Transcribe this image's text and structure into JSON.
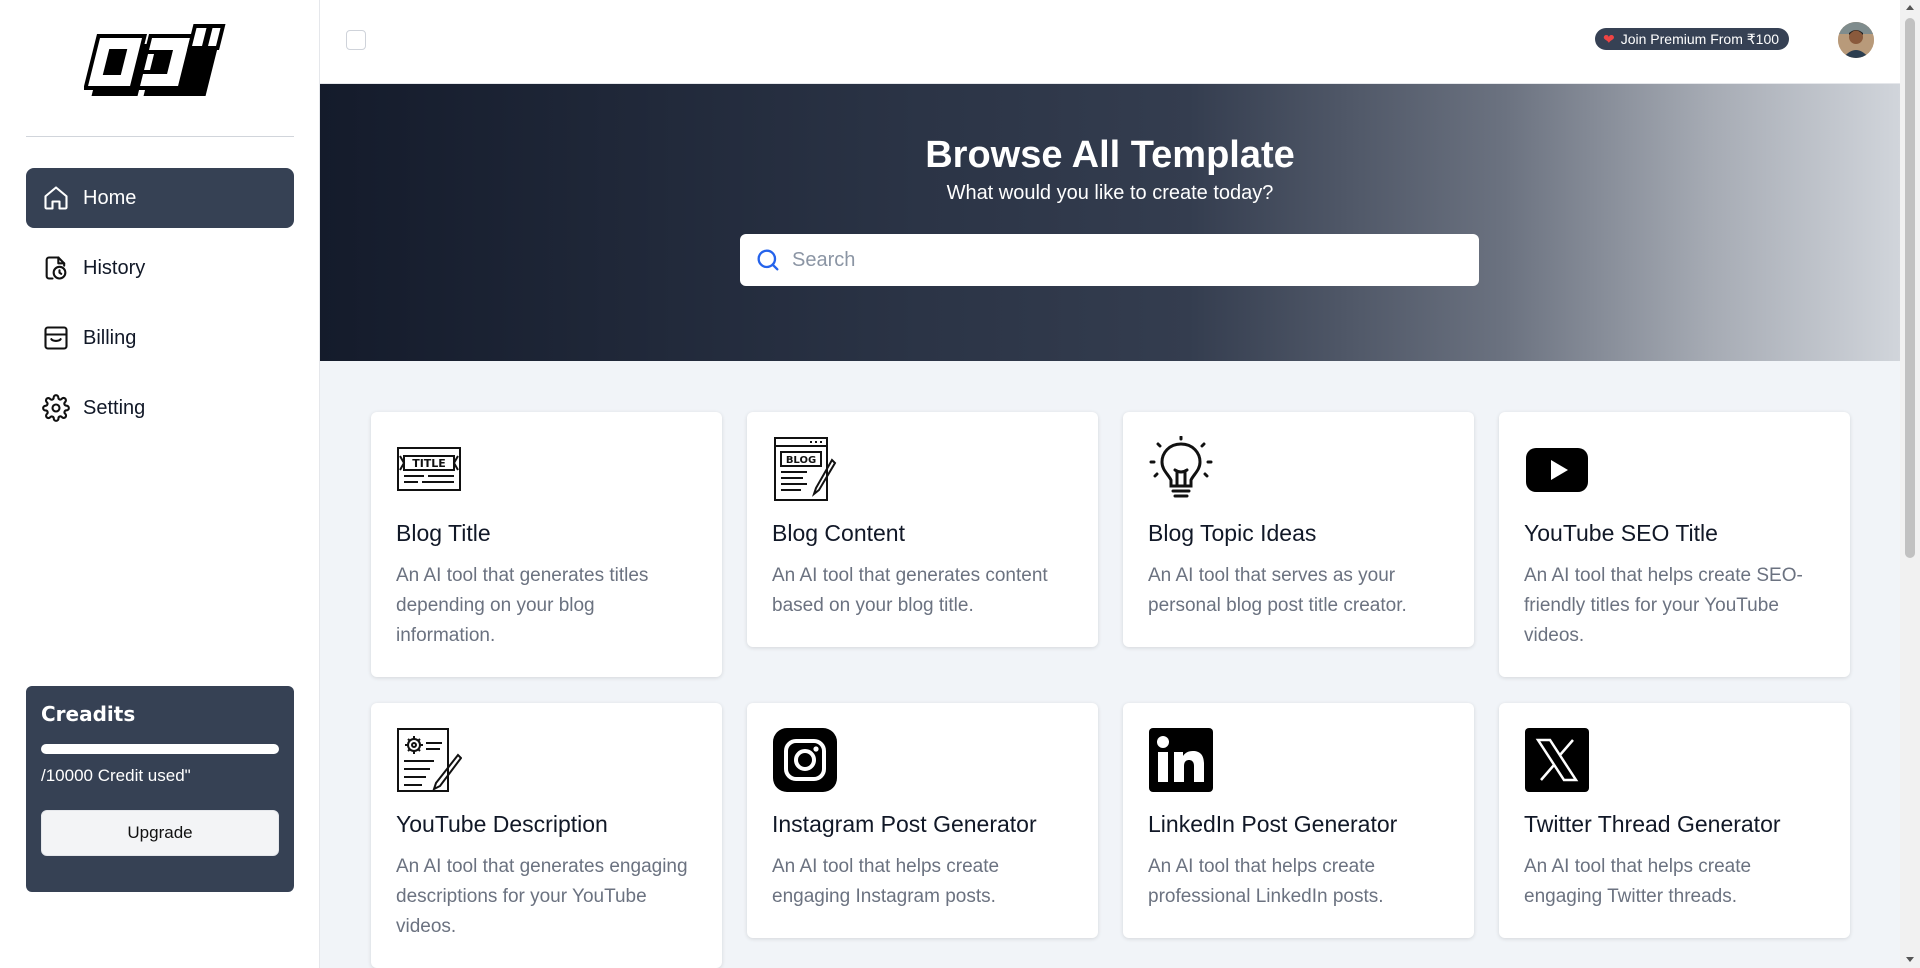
{
  "sidebar": {
    "nav": [
      {
        "label": "Home",
        "icon": "home-icon",
        "active": true
      },
      {
        "label": "History",
        "icon": "history-icon",
        "active": false
      },
      {
        "label": "Billing",
        "icon": "billing-icon",
        "active": false
      },
      {
        "label": "Setting",
        "icon": "gear-icon",
        "active": false
      }
    ],
    "credits": {
      "title": "Creadits",
      "usage_text": "/10000 Credit used\"",
      "upgrade_label": "Upgrade"
    }
  },
  "topbar": {
    "premium_label": "Join Premium From ₹100"
  },
  "hero": {
    "title": "Browse All Template",
    "subtitle": "What would you like to create today?",
    "search_placeholder": "Search"
  },
  "templates": [
    {
      "title": "Blog Title",
      "desc": "An AI tool that generates titles depending on your blog information.",
      "icon": "blog-title-icon"
    },
    {
      "title": "Blog Content",
      "desc": "An AI tool that generates content based on your blog title.",
      "icon": "blog-content-icon"
    },
    {
      "title": "Blog Topic Ideas",
      "desc": "An AI tool that serves as your personal blog post title creator.",
      "icon": "lightbulb-icon"
    },
    {
      "title": "YouTube SEO Title",
      "desc": "An AI tool that helps create SEO-friendly titles for your YouTube videos.",
      "icon": "youtube-icon"
    },
    {
      "title": "YouTube Description",
      "desc": "An AI tool that generates engaging descriptions for your YouTube videos.",
      "icon": "document-settings-icon"
    },
    {
      "title": "Instagram Post Generator",
      "desc": "An AI tool that helps create engaging Instagram posts.",
      "icon": "instagram-icon"
    },
    {
      "title": "LinkedIn Post Generator",
      "desc": "An AI tool that helps create professional LinkedIn posts.",
      "icon": "linkedin-icon"
    },
    {
      "title": "Twitter Thread Generator",
      "desc": "An AI tool that helps create engaging Twitter threads.",
      "icon": "x-twitter-icon"
    }
  ],
  "colors": {
    "accent_dark": "#364154",
    "hero_start": "#141b2b",
    "hero_end": "#d1d5db",
    "page_bg": "#f1f4f8"
  }
}
